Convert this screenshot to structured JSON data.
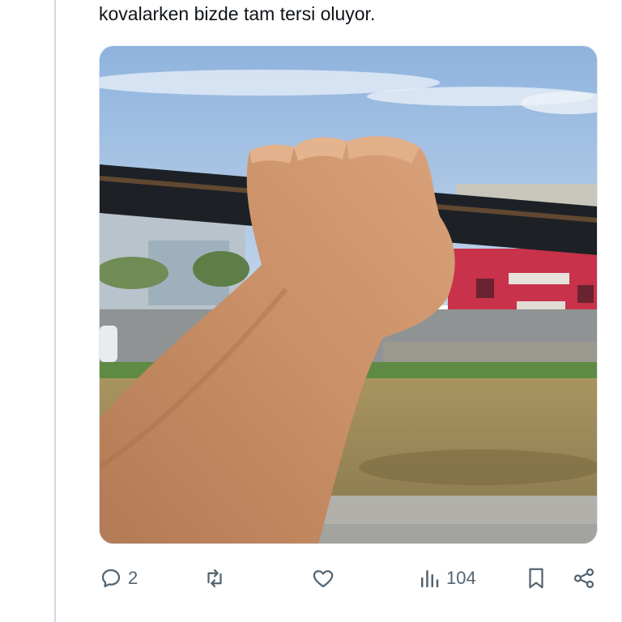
{
  "tweet": {
    "text": "kovalarken bizde tam tersi oluyor."
  },
  "media": {
    "alt": ""
  },
  "actions": {
    "reply": {
      "icon": "reply-icon",
      "count": "2"
    },
    "retweet": {
      "icon": "retweet-icon",
      "count": ""
    },
    "like": {
      "icon": "heart-icon",
      "count": ""
    },
    "views": {
      "icon": "views-icon",
      "count": "104"
    },
    "bookmark": {
      "icon": "bookmark-icon"
    },
    "share": {
      "icon": "share-icon"
    }
  },
  "colors": {
    "text": "#0f1419",
    "muted": "#536471",
    "rule": "#cfd9de"
  }
}
